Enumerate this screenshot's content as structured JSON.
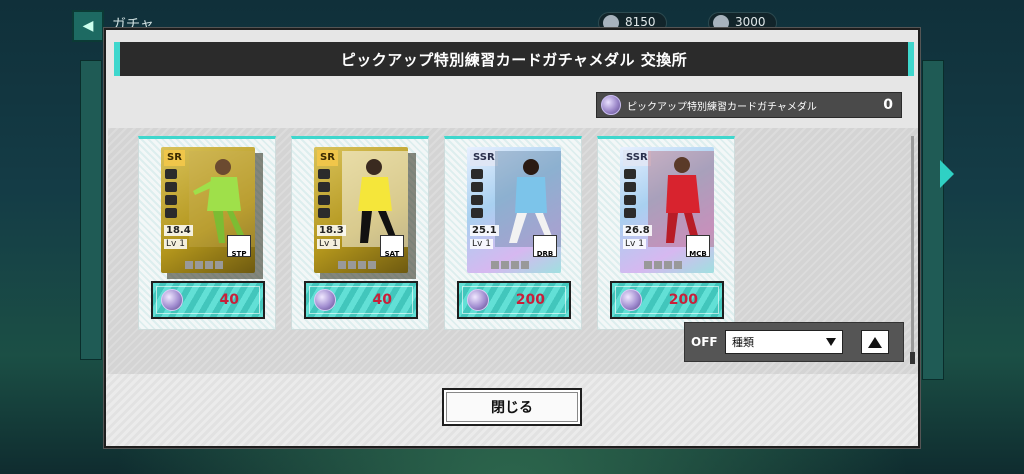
{
  "background": {
    "screen_title": "ガチャ",
    "currency": [
      {
        "icon": "coin-icon",
        "value": "8150"
      },
      {
        "icon": "gem-icon",
        "value": "3000"
      }
    ]
  },
  "modal": {
    "title": "ピックアップ特別練習カードガチャメダル 交換所",
    "medal_counter": {
      "label": "ピックアップ特別練習カードガチャメダル",
      "count": "0"
    },
    "cards": [
      {
        "rarity": "SR",
        "power": "18.4",
        "level": "Lv 1",
        "position": "STP",
        "price": "40",
        "accent": "#9fe04a"
      },
      {
        "rarity": "SR",
        "power": "18.3",
        "level": "Lv 1",
        "position": "SAT",
        "price": "40",
        "accent": "#f5e63a"
      },
      {
        "rarity": "SSR",
        "power": "25.1",
        "level": "Lv 1",
        "position": "DRB",
        "price": "200",
        "accent": "#7cc4ea"
      },
      {
        "rarity": "SSR",
        "power": "26.8",
        "level": "Lv 1",
        "position": "MCB",
        "price": "200",
        "accent": "#d8232e"
      }
    ],
    "filter": {
      "toggle": "OFF",
      "select_value": "種類"
    },
    "close_label": "閉じる"
  }
}
